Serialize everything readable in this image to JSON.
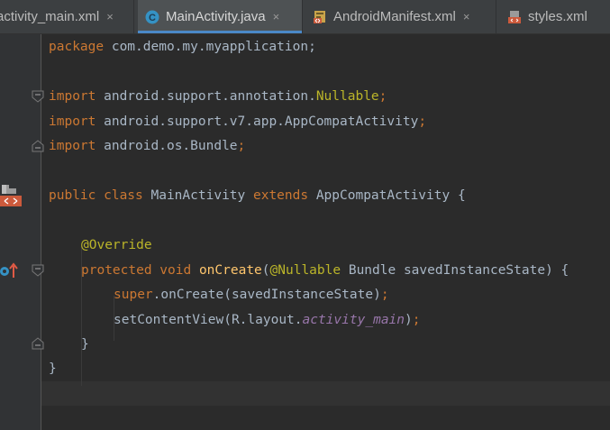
{
  "tabs": [
    {
      "label": "activity_main.xml",
      "active": false,
      "icon": "xml-layout-icon"
    },
    {
      "label": "MainActivity.java",
      "active": true,
      "icon": "java-class-icon"
    },
    {
      "label": "AndroidManifest.xml",
      "active": false,
      "icon": "manifest-icon"
    },
    {
      "label": "styles.xml",
      "active": false,
      "icon": "xml-file-icon"
    }
  ],
  "close_glyph": "×",
  "class_icon_letter": "C",
  "code": {
    "package_kw": "package",
    "package_name": " com.demo.my.myapplication;",
    "import_kw": "import",
    "import1_path": " android.support.annotation.",
    "import1_class": "Nullable",
    "import1_end": ";",
    "import2_path": " android.support.v7.app.AppCompatActivity",
    "import2_end": ";",
    "import3_path": " android.os.Bundle",
    "import3_end": ";",
    "public_class_kw": "public class",
    "class_name": " MainActivity ",
    "extends_kw": "extends",
    "super_class": " AppCompatActivity {",
    "override_ann": "@Override",
    "protected_void_kw": "protected void",
    "method_name": "onCreate",
    "param_open": "(",
    "nullable_ann": "@Nullable",
    "param_rest": " Bundle savedInstanceState) {",
    "super_kw": "super",
    "super_call": ".onCreate(savedInstanceState)",
    "super_end": ";",
    "set_content_call": "setContentView(R.layout.",
    "layout_field": "activity_main",
    "set_content_close": ")",
    "set_content_end": ";",
    "method_close": "}",
    "class_close": "}"
  },
  "colors": {
    "background": "#2b2b2b",
    "keyword": "#cc7832",
    "annotation": "#bbb529",
    "field": "#9876aa",
    "text": "#a9b7c6",
    "active_tab_underline": "#4a88c7"
  }
}
